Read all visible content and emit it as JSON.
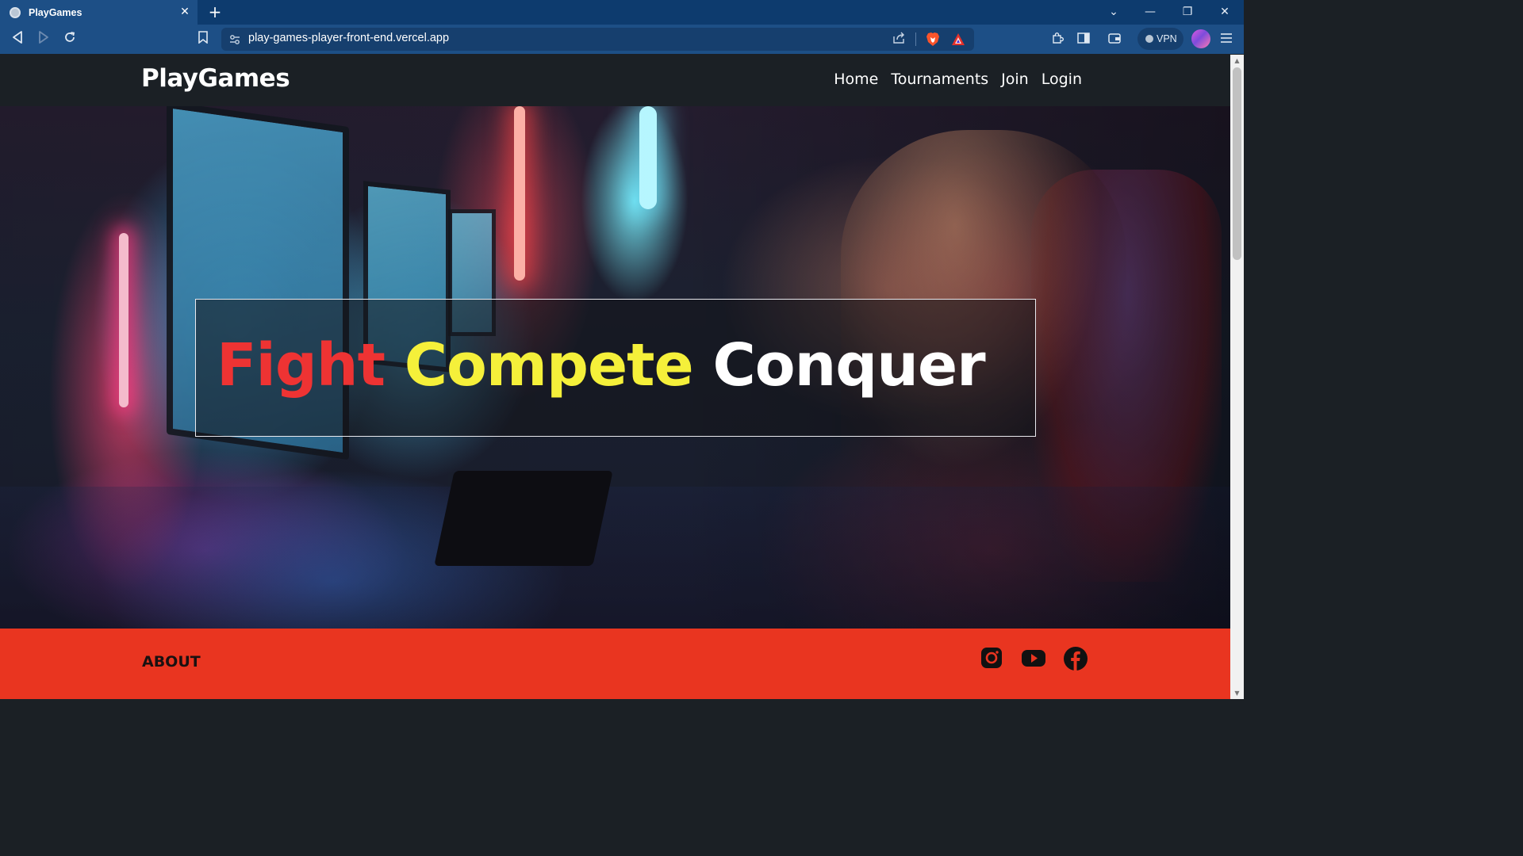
{
  "browser": {
    "tab_title": "PlayGames",
    "tab_close": "✕",
    "new_tab": "+",
    "url": "play-games-player-front-end.vercel.app",
    "vpn_label": "VPN",
    "win_controls": {
      "list": "⌄",
      "minimize": "—",
      "restore": "❐",
      "close": "✕"
    }
  },
  "site": {
    "brand": "PlayGames",
    "nav": [
      "Home",
      "Tournaments",
      "Join",
      "Login"
    ],
    "hero": {
      "word1": "Fight",
      "word2": "Compete",
      "word3": "Conquer"
    },
    "footer": {
      "about": "ABOUT"
    },
    "social_icons": [
      "instagram-icon",
      "youtube-icon",
      "facebook-icon"
    ]
  },
  "colors": {
    "tabbar": "#0d3b6e",
    "toolbar": "#1d4f86",
    "nav_bg": "#1b2025",
    "fight": "#ee3333",
    "compete": "#f5f03a",
    "conquer": "#ffffff",
    "footer_bg": "#e93520"
  }
}
